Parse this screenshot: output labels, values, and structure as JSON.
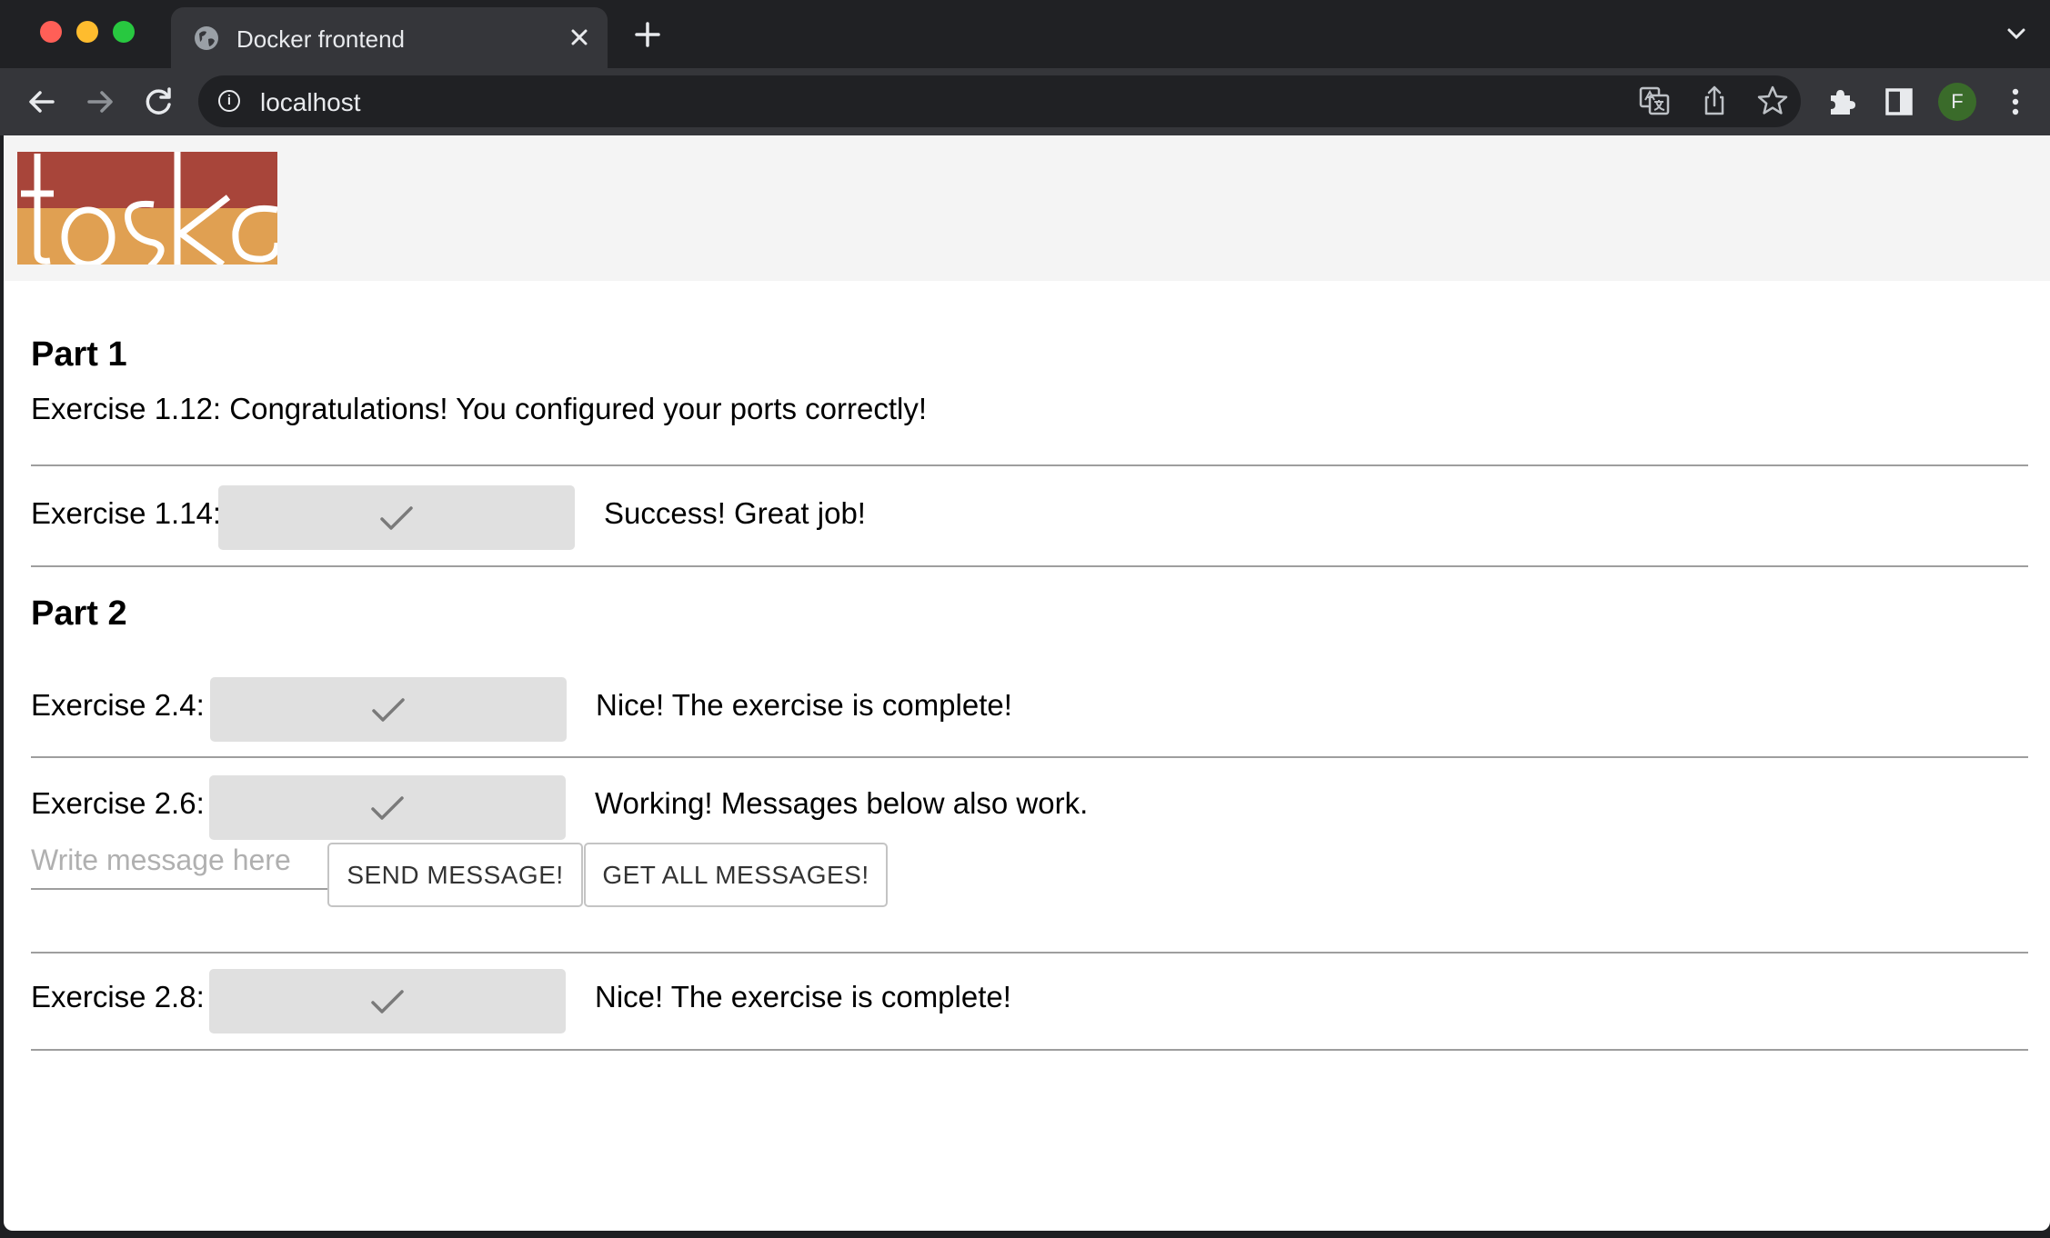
{
  "browser": {
    "tab_title": "Docker frontend",
    "url": "localhost",
    "profile_initial": "F"
  },
  "header": {
    "logo_text": "toska"
  },
  "part1": {
    "title": "Part 1",
    "ex1_12": "Exercise 1.12: Congratulations! You configured your ports correctly!",
    "ex1_14_label": "Exercise 1.14:",
    "ex1_14_result": "Success! Great job!"
  },
  "part2": {
    "title": "Part 2",
    "ex2_4_label": "Exercise 2.4:",
    "ex2_4_result": "Nice! The exercise is complete!",
    "ex2_6_label": "Exercise 2.6:",
    "ex2_6_result": "Working! Messages below also work.",
    "message_placeholder": "Write message here",
    "send_button": "SEND MESSAGE!",
    "get_all_button": "GET ALL MESSAGES!",
    "ex2_8_label": "Exercise 2.8:",
    "ex2_8_result": "Nice! The exercise is complete!"
  },
  "colors": {
    "logo_red": "#a8453a",
    "logo_orange": "#e0a052",
    "check_button_bg": "#e0e0e0"
  }
}
